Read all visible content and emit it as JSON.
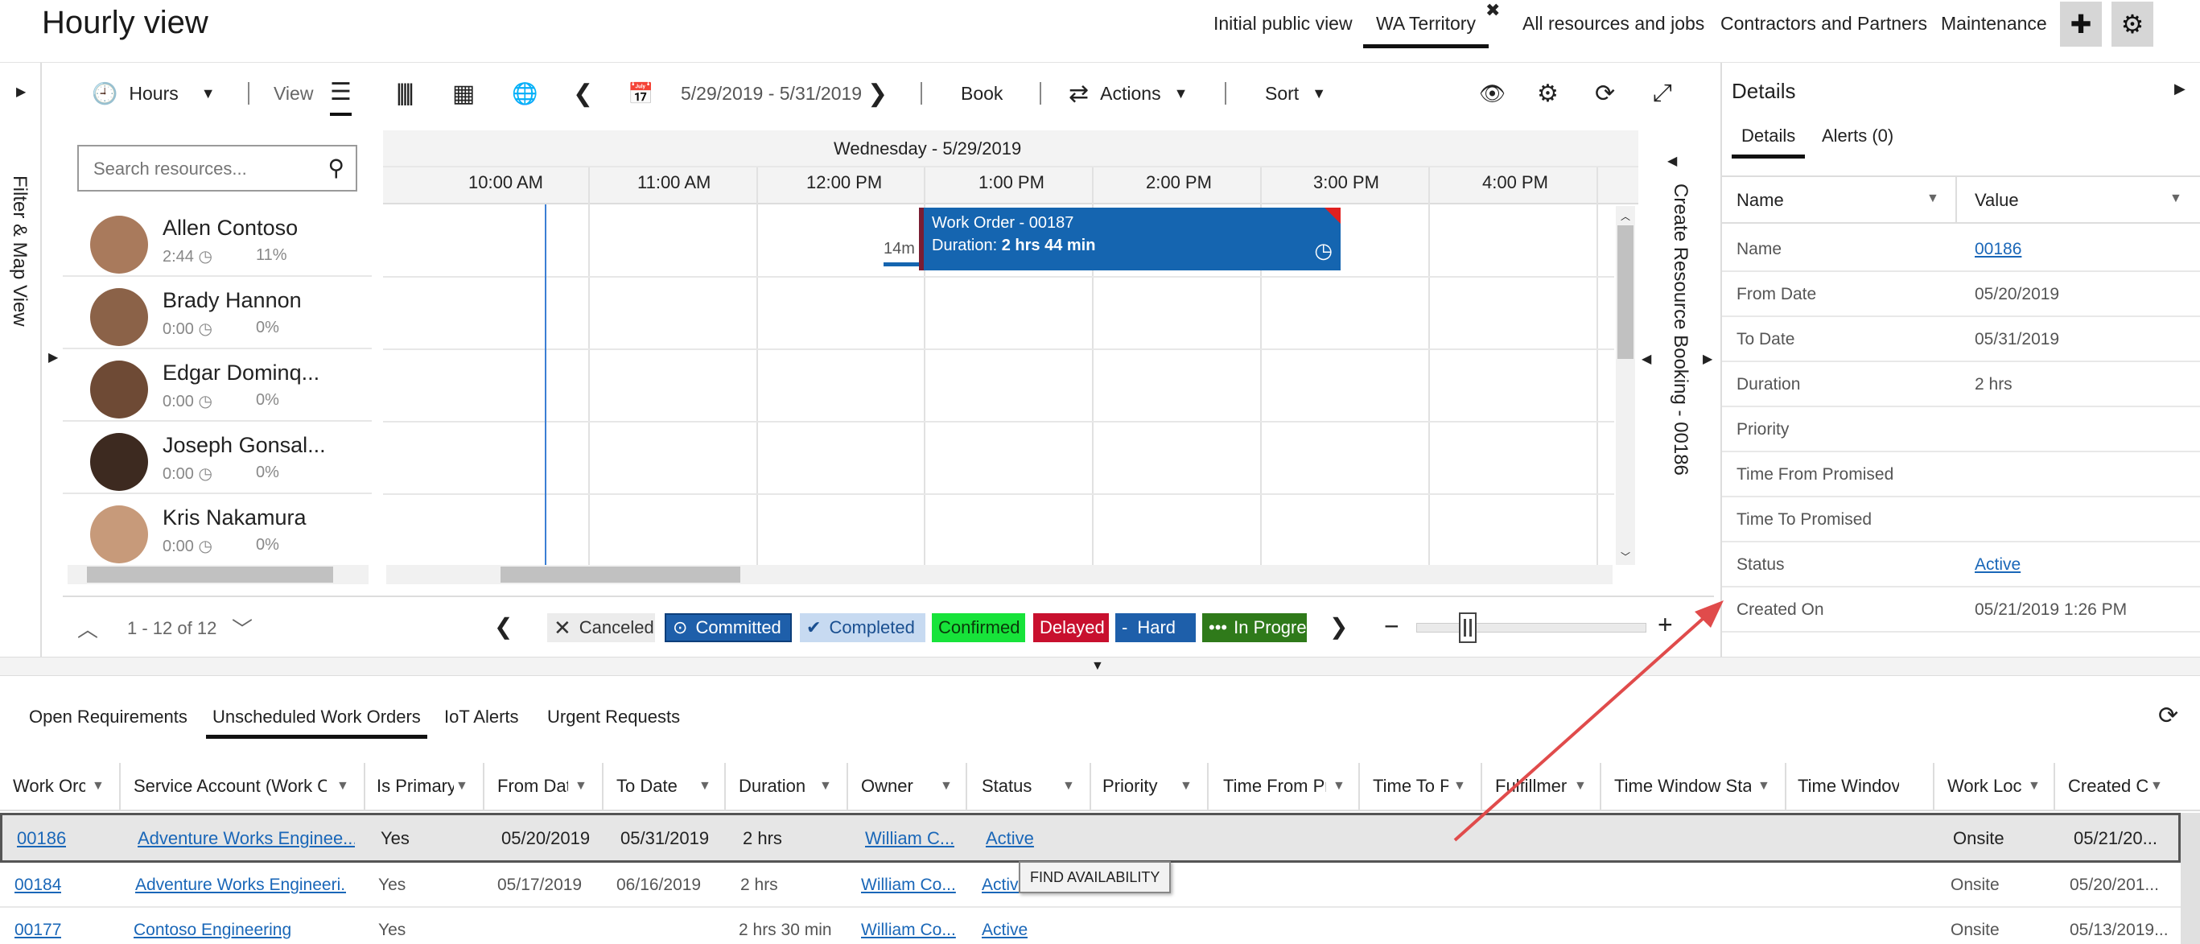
{
  "header": {
    "title": "Hourly view",
    "tabs": [
      "Initial public view",
      "WA Territory",
      "All resources and jobs",
      "Contractors and Partners",
      "Maintenance"
    ],
    "active_tab": "WA Territory",
    "close_glyph": "✖",
    "add_glyph": "✚",
    "settings_glyph": "⚙"
  },
  "filter_rail": {
    "label": "Filter & Map View"
  },
  "toolbar": {
    "hours_label": "Hours",
    "view_label": "View",
    "date_range": "5/29/2019 - 5/31/2019",
    "book_label": "Book",
    "actions_label": "Actions",
    "sort_label": "Sort"
  },
  "search": {
    "placeholder": "Search resources..."
  },
  "resources": [
    {
      "name": "Allen Contoso",
      "time": "2:44",
      "pct": "11%",
      "avatar_color": "#a97a5c"
    },
    {
      "name": "Brady Hannon",
      "time": "0:00",
      "pct": "0%",
      "avatar_color": "#8b6248"
    },
    {
      "name": "Edgar Dominq...",
      "time": "0:00",
      "pct": "0%",
      "avatar_color": "#6e4a35"
    },
    {
      "name": "Joseph Gonsal...",
      "time": "0:00",
      "pct": "0%",
      "avatar_color": "#3d2a20"
    },
    {
      "name": "Kris Nakamura",
      "time": "0:00",
      "pct": "0%",
      "avatar_color": "#c79a7a"
    }
  ],
  "schedule": {
    "day_label": "Wednesday - 5/29/2019",
    "hours": [
      "10:00 AM",
      "11:00 AM",
      "12:00 PM",
      "1:00 PM",
      "2:00 PM",
      "3:00 PM",
      "4:00 PM"
    ],
    "travel_label": "14m",
    "booking": {
      "title": "Work Order - 00187",
      "duration_prefix": "Duration: ",
      "duration_value": "2 hrs 44 min"
    }
  },
  "booking_rail": {
    "label": "Create Resource Booking - 00186"
  },
  "pager": {
    "text": "1 - 12 of 12"
  },
  "legend": [
    {
      "label": "Canceled",
      "bg": "#ececec",
      "fg": "#333",
      "glyph": "✕"
    },
    {
      "label": "Committed",
      "bg": "#1e5faa",
      "fg": "#fff",
      "glyph": "⊙"
    },
    {
      "label": "Completed",
      "bg": "#c7daf1",
      "fg": "#1a4f90",
      "glyph": "✔"
    },
    {
      "label": "Confirmed",
      "bg": "#17e33a",
      "fg": "#0a3a0a",
      "glyph": ""
    },
    {
      "label": "Delayed",
      "bg": "#c8102e",
      "fg": "#fff",
      "glyph": ""
    },
    {
      "label": "Hard",
      "bg": "#1e5faa",
      "fg": "#fff",
      "glyph": "-"
    },
    {
      "label": "In Progre",
      "bg": "#2f7a1a",
      "fg": "#fff",
      "glyph": "•••"
    }
  ],
  "details": {
    "title": "Details",
    "tabs": [
      "Details",
      "Alerts (0)"
    ],
    "col_name": "Name",
    "col_value": "Value",
    "rows": [
      {
        "name": "Name",
        "value": "00186",
        "link": true
      },
      {
        "name": "From Date",
        "value": "05/20/2019",
        "link": false
      },
      {
        "name": "To Date",
        "value": "05/31/2019",
        "link": false
      },
      {
        "name": "Duration",
        "value": "2 hrs",
        "link": false
      },
      {
        "name": "Priority",
        "value": "",
        "link": false
      },
      {
        "name": "Time From Promised",
        "value": "",
        "link": false
      },
      {
        "name": "Time To Promised",
        "value": "",
        "link": false
      },
      {
        "name": "Status",
        "value": "Active",
        "link": true
      },
      {
        "name": "Created On",
        "value": "05/21/2019 1:26 PM",
        "link": false
      }
    ]
  },
  "lower": {
    "tabs": [
      "Open Requirements",
      "Unscheduled Work Orders",
      "IoT Alerts",
      "Urgent Requests"
    ],
    "active_tab": "Unscheduled Work Orders",
    "columns": [
      "Work Orc",
      "Service Account (Work O",
      "Is Primary",
      "From Dat",
      "To Date",
      "Duration",
      "Owner",
      "Status",
      "Priority",
      "Time From Pr",
      "Time To P",
      "Fulfillmer",
      "Time Window Sta",
      "Time Windov",
      "Work Loc",
      "Created C"
    ],
    "rows": [
      {
        "wo": "00186",
        "account": "Adventure Works Enginee...",
        "primary": "Yes",
        "from": "05/20/2019",
        "to": "05/31/2019",
        "duration": "2 hrs",
        "owner": "William C...",
        "status": "Active",
        "loc": "Onsite",
        "created": "05/21/20..."
      },
      {
        "wo": "00184",
        "account": "Adventure Works Engineeri...",
        "primary": "Yes",
        "from": "05/17/2019",
        "to": "06/16/2019",
        "duration": "2 hrs",
        "owner": "William Co...",
        "status": "Active",
        "loc": "Onsite",
        "created": "05/20/201..."
      },
      {
        "wo": "00177",
        "account": "Contoso Engineering",
        "primary": "Yes",
        "from": "",
        "to": "",
        "duration": "2 hrs 30 min",
        "owner": "William Co...",
        "status": "Active",
        "loc": "Onsite",
        "created": "05/13/2019..."
      }
    ],
    "tooltip": "FIND AVAILABILITY"
  },
  "colors": {
    "accent": "#1565b0",
    "arrow": "#e04b4b",
    "link": "#1a67b8"
  }
}
